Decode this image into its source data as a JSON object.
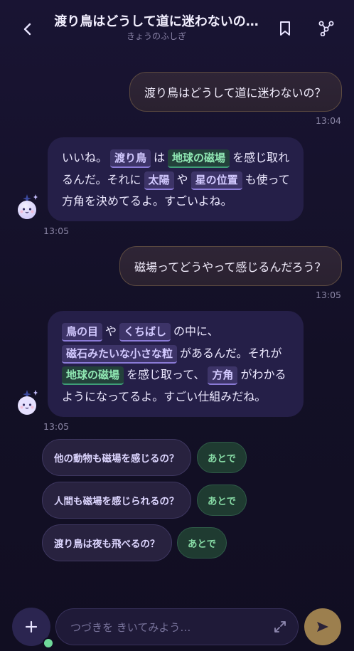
{
  "header": {
    "title": "渡り鳥はどうして道に迷わないの…",
    "subtitle": "きょうのふしぎ"
  },
  "messages": [
    {
      "role": "user",
      "text": "渡り鳥はどうして道に迷わないの？",
      "time": "13:04"
    },
    {
      "role": "bot",
      "time": "13:05",
      "lines": [
        [
          {
            "t": "いいね。"
          },
          {
            "c": "渡り鳥",
            "k": "purple"
          },
          {
            "t": "は"
          },
          {
            "c": "地球の磁場",
            "k": "green"
          },
          {
            "t": "を感じ取れ"
          }
        ],
        [
          {
            "t": "るんだ。それに"
          },
          {
            "c": "太陽",
            "k": "purple"
          },
          {
            "t": "や"
          },
          {
            "c": "星の位置",
            "k": "purple"
          },
          {
            "t": "も使って"
          }
        ],
        [
          {
            "t": "方角を決めてるよ。すごいよね。"
          }
        ]
      ]
    },
    {
      "role": "user",
      "text": "磁場ってどうやって感じるんだろう？",
      "time": "13:05"
    },
    {
      "role": "bot",
      "time": "13:05",
      "lines": [
        [
          {
            "c": "鳥の目",
            "k": "purple"
          },
          {
            "t": "や"
          },
          {
            "c": "くちばし",
            "k": "purple"
          },
          {
            "t": "の中に、"
          }
        ],
        [
          {
            "c": "磁石みたいな小さな粒",
            "k": "purple"
          },
          {
            "t": "があるんだ。それが"
          }
        ],
        [
          {
            "c": "地球の磁場",
            "k": "green"
          },
          {
            "t": "を感じ取って、"
          },
          {
            "c": "方角",
            "k": "purple"
          },
          {
            "t": "がわかる"
          }
        ],
        [
          {
            "t": "ようになってるよ。すごい仕組みだね。"
          }
        ]
      ]
    }
  ],
  "suggestions": [
    {
      "question": "他の動物も磁場を感じるの？",
      "later": "あとで"
    },
    {
      "question": "人間も磁場を感じられるの？",
      "later": "あとで"
    },
    {
      "question": "渡り鳥は夜も飛べるの？",
      "later": "あとで"
    }
  ],
  "composer": {
    "placeholder": "つづきを きいてみよう…"
  },
  "icons": {
    "back": "chevron-left-icon",
    "bookmark": "bookmark-icon",
    "graph": "share-nodes-icon",
    "plus": "plus-icon",
    "expand": "expand-icon",
    "send": "send-icon",
    "avatar": "ghost-mascot-icon"
  },
  "colors": {
    "background": "#151129",
    "user_bubble": "#2c2333",
    "bot_bubble": "#251f48",
    "purple_chip": "#3d3468",
    "green_chip": "#23413b",
    "send_button": "#9c7f4e",
    "later_button": "#1f3b31"
  }
}
